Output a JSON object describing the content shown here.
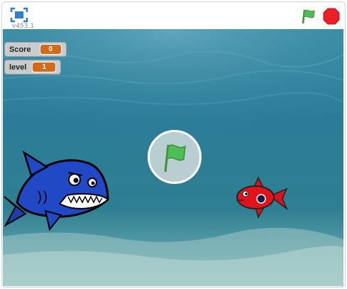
{
  "app": {
    "version": "v453.1",
    "controls": {
      "fullscreen_icon": "fullscreen-icon",
      "green_flag_icon": "green-flag-icon",
      "stop_icon": "stop-sign-icon"
    }
  },
  "stage": {
    "monitors": [
      {
        "label": "Score",
        "value": "0"
      },
      {
        "label": "level",
        "value": "1"
      }
    ],
    "overlay_icon": "green-flag-icon",
    "sprites": [
      "blue-shark",
      "red-fish"
    ]
  },
  "colors": {
    "accent": "#4c97ff",
    "flag_green": "#4cbf56",
    "stop_red": "#ec5959",
    "monitor_value_bg": "#d26c1b",
    "water_top": "#2e83a2",
    "water_bottom": "#4f9ba9"
  }
}
